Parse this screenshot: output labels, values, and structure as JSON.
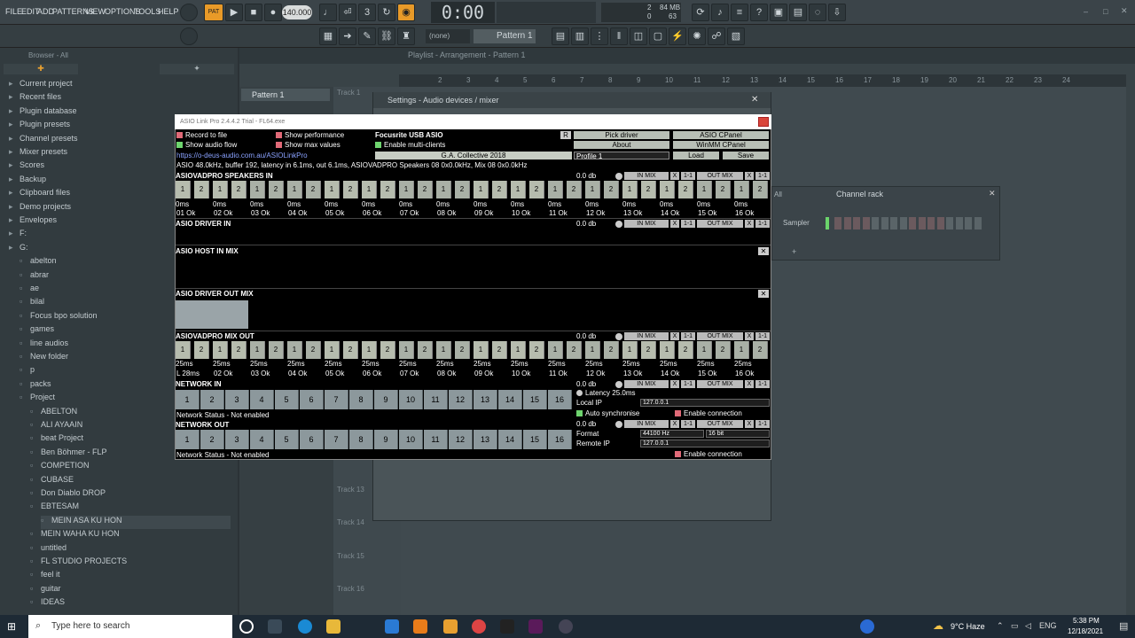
{
  "menu": [
    "FILE",
    "EDIT",
    "ADD",
    "PATTERNS",
    "VIEW",
    "OPTIONS",
    "TOOLS",
    "HELP"
  ],
  "transport": {
    "mode": "PAT",
    "tempo": "140.000",
    "time": "0:00",
    "time_unit": "M:S:CS",
    "cpu_mb": "84 MB",
    "cpu_a": "2",
    "cpu_b": "63",
    "cpu_c": "0"
  },
  "toolbar2": {
    "pattern_select": "(none)",
    "pattern": "Pattern 1"
  },
  "browser": {
    "header": "Browser - All",
    "items": [
      "Current project",
      "Recent files",
      "Plugin database",
      "Plugin presets",
      "Channel presets",
      "Mixer presets",
      "Scores",
      "Backup",
      "Clipboard files",
      "Demo projects",
      "Envelopes",
      "F:",
      "G:",
      "abelton",
      "abrar",
      "ae",
      "bilal",
      "Focus bpo solution",
      "games",
      "line audios",
      "New folder",
      "p",
      "packs",
      "Project",
      "ABELTON",
      "ALI AYAAIN",
      "beat Project",
      "Ben Böhmer - FLP",
      "COMPETION",
      "CUBASE",
      "Don Diablo DROP",
      "EBTESAM",
      "MEIN ASA KU HON",
      "MEIN WAHA KU HON",
      "untitled",
      "FL STUDIO PROJECTS",
      "feel it",
      "guitar",
      "IDEAS"
    ]
  },
  "playlist": {
    "title": "Playlist - Arrangement - Pattern 1",
    "pattern_item": "Pattern 1",
    "track1": "Track 1",
    "tracks": [
      "Track 13",
      "Track 14",
      "Track 15",
      "Track 16"
    ],
    "ruler": [
      "2",
      "3",
      "4",
      "5",
      "6",
      "7",
      "8",
      "9",
      "10",
      "11",
      "12",
      "13",
      "14",
      "15",
      "16",
      "17",
      "18",
      "19",
      "20",
      "21",
      "22",
      "23",
      "24"
    ]
  },
  "channel_rack": {
    "title": "Channel rack",
    "filter": "All",
    "channel": "Sampler"
  },
  "settings": {
    "title": "Settings - Audio devices / mixer"
  },
  "asio": {
    "title": "ASIO Link Pro 2.4.4.2 Trial - FL64.exe",
    "opt_record": "Record to file",
    "opt_perf": "Show performance",
    "opt_flow": "Show audio flow",
    "opt_max": "Show max values",
    "opt_multi": "Enable multi-clients",
    "device": "Focusrite USB ASIO",
    "r": "R",
    "license": "G.A. Collective 2018",
    "url": "https://o-deus-audio.com.au/ASIOLinkPro",
    "btn_pick": "Pick driver",
    "btn_cpanel": "ASIO CPanel",
    "btn_about": "About",
    "btn_winmm": "WinMM CPanel",
    "profile": "Profile 1",
    "btn_load": "Load",
    "btn_save": "Save",
    "status": "ASIO 48.0kHz, buffer 192, latency in 6.1ms, out 6.1ms, ASIOVADPRO Speakers 08 0x0.0kHz, Mix 08 0x0.0kHz",
    "sec_speakers_in": "ASIOVADPRO SPEAKERS IN",
    "sec_driver_in": "ASIO DRIVER IN",
    "sec_host_in": "ASIO HOST IN MIX",
    "sec_driver_out": "ASIO DRIVER OUT MIX",
    "sec_mix_out": "ASIOVADPRO MIX OUT",
    "sec_net_in": "NETWORK IN",
    "sec_net_out": "NETWORK OUT",
    "db": "0.0 db",
    "in_mix": "IN MIX",
    "out_mix": "OUT MIX",
    "link": "1-1",
    "x": "X",
    "lat_ms": "0ms",
    "lat25": "25ms",
    "ok_labels": [
      "01 Ok",
      "02 Ok",
      "03 Ok",
      "04 Ok",
      "05 Ok",
      "06 Ok",
      "07 Ok",
      "08 Ok",
      "09 Ok",
      "10 Ok",
      "11 Ok",
      "12 Ok",
      "13 Ok",
      "14 Ok",
      "15 Ok",
      "16 Ok"
    ],
    "mix_labels": [
      "L 28ms",
      "02 Ok",
      "03 Ok",
      "04 Ok",
      "05 Ok",
      "06 Ok",
      "07 Ok",
      "08 Ok",
      "09 Ok",
      "10 Ok",
      "11 Ok",
      "12 Ok",
      "13 Ok",
      "14 Ok",
      "15 Ok",
      "16 Ok"
    ],
    "net_nums": [
      "1",
      "2",
      "3",
      "4",
      "5",
      "6",
      "7",
      "8",
      "9",
      "10",
      "11",
      "12",
      "13",
      "14",
      "15",
      "16"
    ],
    "net_status": "Network Status - Not enabled",
    "latency": "Latency 25.0ms",
    "local_ip_label": "Local IP",
    "local_ip": "127.0.0.1",
    "auto_sync": "Auto synchronise",
    "enable_conn": "Enable connection",
    "format_label": "Format",
    "format_val": "44100 Hz",
    "bits": "16 bit",
    "remote_label": "Remote IP",
    "remote_ip": "127.0.0.1"
  },
  "taskbar": {
    "search": "Type here to search",
    "weather": "9°C Haze",
    "time": "5:38 PM",
    "date": "12/18/2021",
    "lang": "ENG"
  }
}
